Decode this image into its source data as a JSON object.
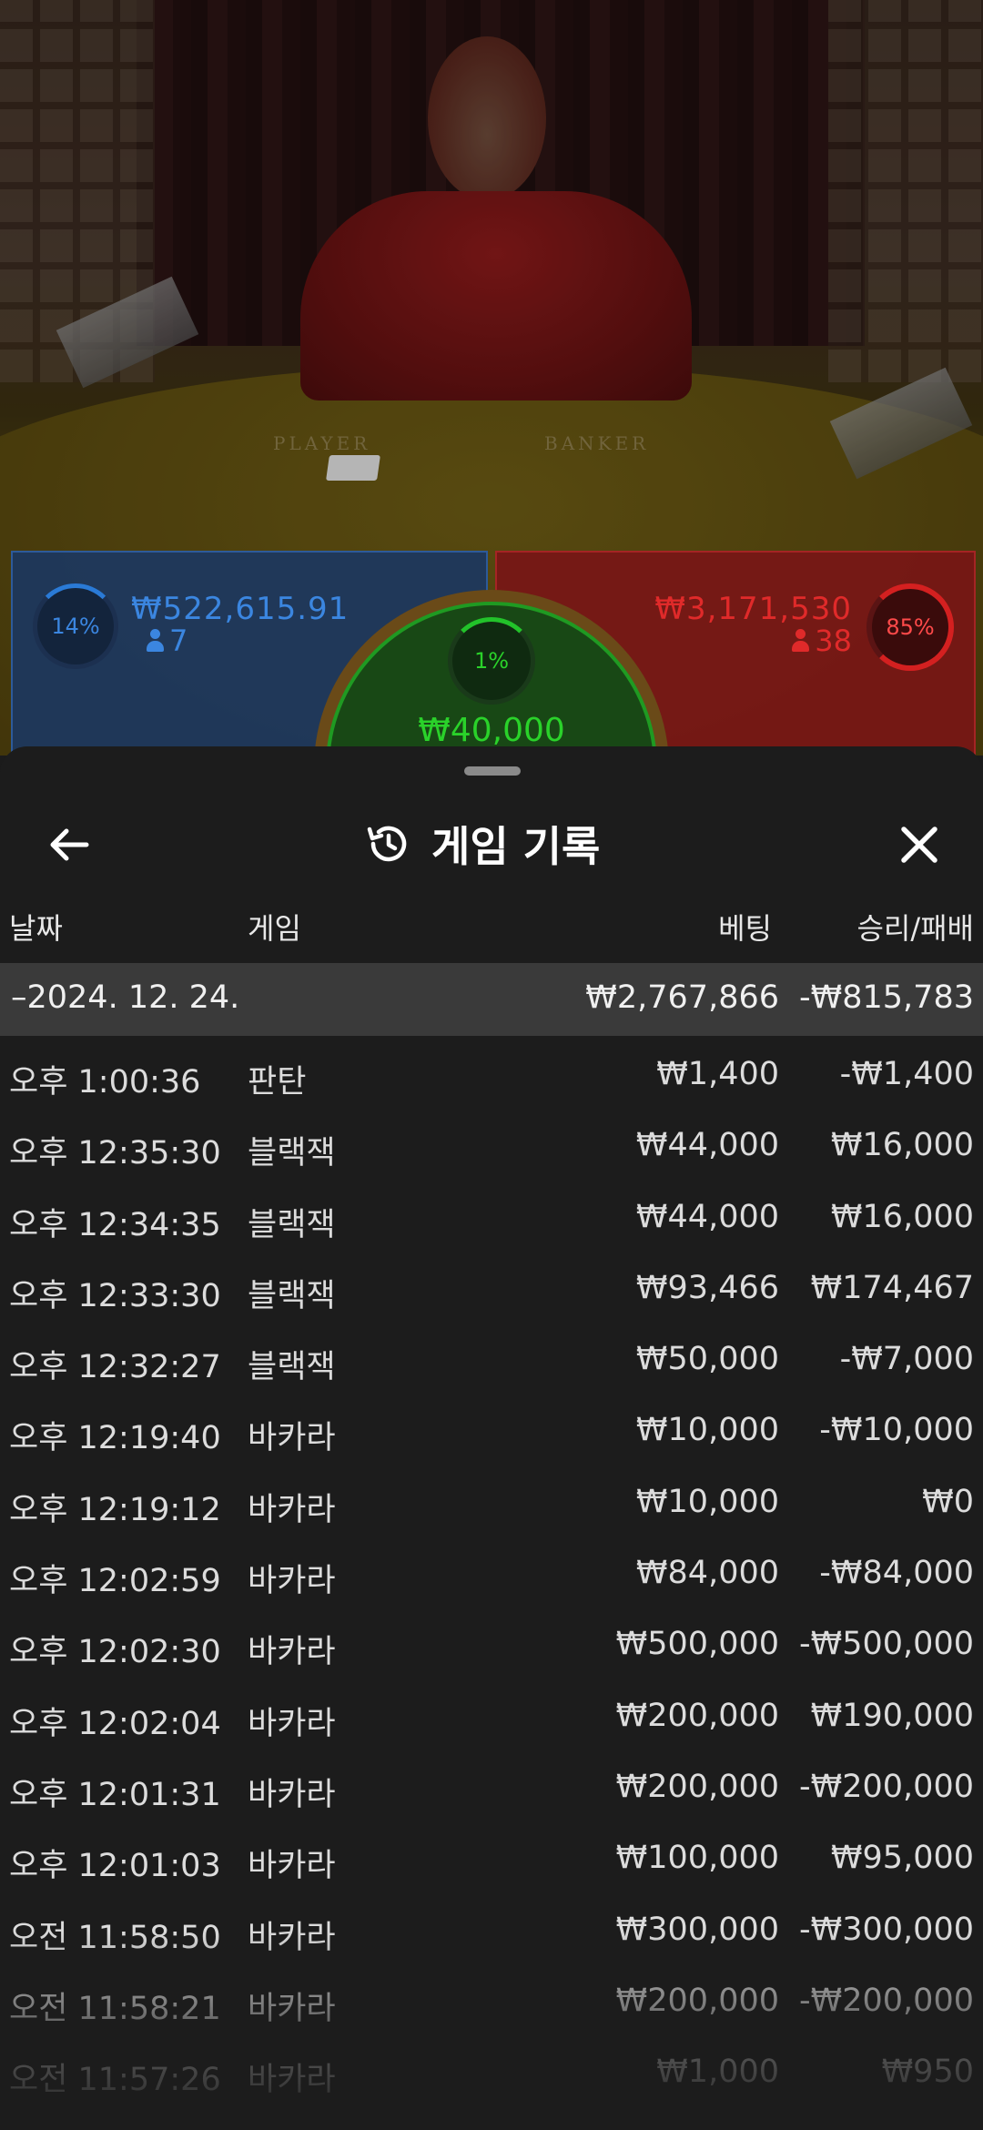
{
  "video": {
    "table_player_label": "PLAYER",
    "table_banker_label": "BANKER"
  },
  "bets": {
    "player": {
      "percent": "14%",
      "amount": "₩522,615.91",
      "count": "7",
      "color": "#3b86e0"
    },
    "tie": {
      "percent": "1%",
      "amount": "₩40,000",
      "color": "#2ad22a"
    },
    "banker": {
      "percent": "85%",
      "amount": "₩3,171,530",
      "count": "38",
      "color": "#e02a2a"
    }
  },
  "history": {
    "title": "게임 기록",
    "columns": {
      "date": "날짜",
      "game": "게임",
      "bet": "베팅",
      "result": "승리/패배"
    },
    "group": {
      "date": "–2024. 12. 24.",
      "bet": "₩2,767,866",
      "result": "-₩815,783"
    },
    "rows": [
      {
        "time": "오후 1:00:36",
        "game": "판탄",
        "bet": "₩1,400",
        "result": "-₩1,400"
      },
      {
        "time": "오후 12:35:30",
        "game": "블랙잭",
        "bet": "₩44,000",
        "result": "₩16,000"
      },
      {
        "time": "오후 12:34:35",
        "game": "블랙잭",
        "bet": "₩44,000",
        "result": "₩16,000"
      },
      {
        "time": "오후 12:33:30",
        "game": "블랙잭",
        "bet": "₩93,466",
        "result": "₩174,467"
      },
      {
        "time": "오후 12:32:27",
        "game": "블랙잭",
        "bet": "₩50,000",
        "result": "-₩7,000"
      },
      {
        "time": "오후 12:19:40",
        "game": "바카라",
        "bet": "₩10,000",
        "result": "-₩10,000"
      },
      {
        "time": "오후 12:19:12",
        "game": "바카라",
        "bet": "₩10,000",
        "result": "₩0"
      },
      {
        "time": "오후 12:02:59",
        "game": "바카라",
        "bet": "₩84,000",
        "result": "-₩84,000"
      },
      {
        "time": "오후 12:02:30",
        "game": "바카라",
        "bet": "₩500,000",
        "result": "-₩500,000"
      },
      {
        "time": "오후 12:02:04",
        "game": "바카라",
        "bet": "₩200,000",
        "result": "₩190,000"
      },
      {
        "time": "오후 12:01:31",
        "game": "바카라",
        "bet": "₩200,000",
        "result": "-₩200,000"
      },
      {
        "time": "오후 12:01:03",
        "game": "바카라",
        "bet": "₩100,000",
        "result": "₩95,000"
      },
      {
        "time": "오전 11:58:50",
        "game": "바카라",
        "bet": "₩300,000",
        "result": "-₩300,000"
      },
      {
        "time": "오전 11:58:21",
        "game": "바카라",
        "bet": "₩200,000",
        "result": "-₩200,000"
      },
      {
        "time": "오전 11:57:26",
        "game": "바카라",
        "bet": "₩1,000",
        "result": "₩950"
      }
    ]
  },
  "icons": {
    "back": "arrow-left-icon",
    "history": "history-clock-icon",
    "close": "close-icon",
    "person": "person-icon"
  }
}
